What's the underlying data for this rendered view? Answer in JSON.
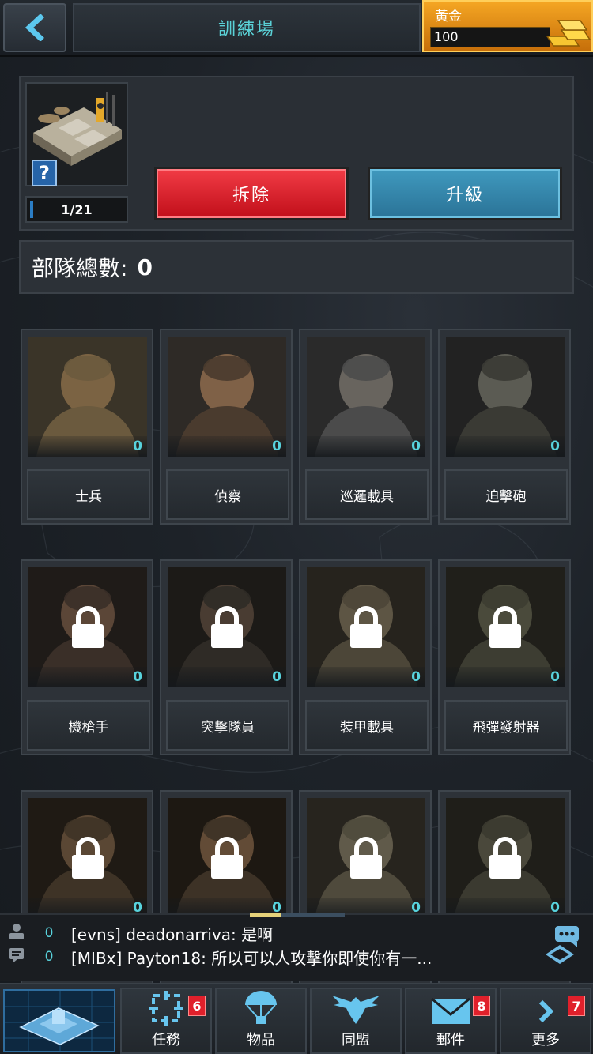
{
  "header": {
    "title": "訓練場",
    "gold_label": "黃金",
    "gold_value": "100"
  },
  "building": {
    "level": "1/21",
    "demolish_label": "拆除",
    "upgrade_label": "升級"
  },
  "troops": {
    "total_label": "部隊總數:",
    "total_value": "0"
  },
  "units": [
    {
      "name": "士兵",
      "count": "0",
      "locked": false
    },
    {
      "name": "偵察",
      "count": "0",
      "locked": false
    },
    {
      "name": "巡邏載具",
      "count": "0",
      "locked": false
    },
    {
      "name": "迫擊砲",
      "count": "0",
      "locked": false
    },
    {
      "name": "機槍手",
      "count": "0",
      "locked": true
    },
    {
      "name": "突擊隊員",
      "count": "0",
      "locked": true
    },
    {
      "name": "裝甲載具",
      "count": "0",
      "locked": true
    },
    {
      "name": "飛彈發射器",
      "count": "0",
      "locked": true
    },
    {
      "name": "",
      "count": "0",
      "locked": true
    },
    {
      "name": "",
      "count": "0",
      "locked": true
    },
    {
      "name": "",
      "count": "0",
      "locked": true
    },
    {
      "name": "",
      "count": "0",
      "locked": true
    }
  ],
  "chat": {
    "rows": [
      {
        "icon": "person-icon",
        "count": "0",
        "message": "[evns] deadonarriva: 是啊"
      },
      {
        "icon": "chat-bubble-icon",
        "count": "0",
        "message": "[MIBx] Payton18: 所以可以人攻擊你即使你有一..."
      }
    ]
  },
  "nav": {
    "items": [
      {
        "label": "任務",
        "badge": "6",
        "icon": "target-icon"
      },
      {
        "label": "物品",
        "badge": "",
        "icon": "parachute-icon"
      },
      {
        "label": "同盟",
        "badge": "",
        "icon": "eagle-icon"
      },
      {
        "label": "郵件",
        "badge": "8",
        "icon": "mail-icon"
      },
      {
        "label": "更多",
        "badge": "7",
        "icon": "chevron-right-icon"
      }
    ]
  },
  "colors": {
    "accent": "#58d3dd",
    "demolish": "#d8212b",
    "upgrade": "#3a8db3",
    "gold": "#f0a020",
    "badge": "#e0202b"
  }
}
